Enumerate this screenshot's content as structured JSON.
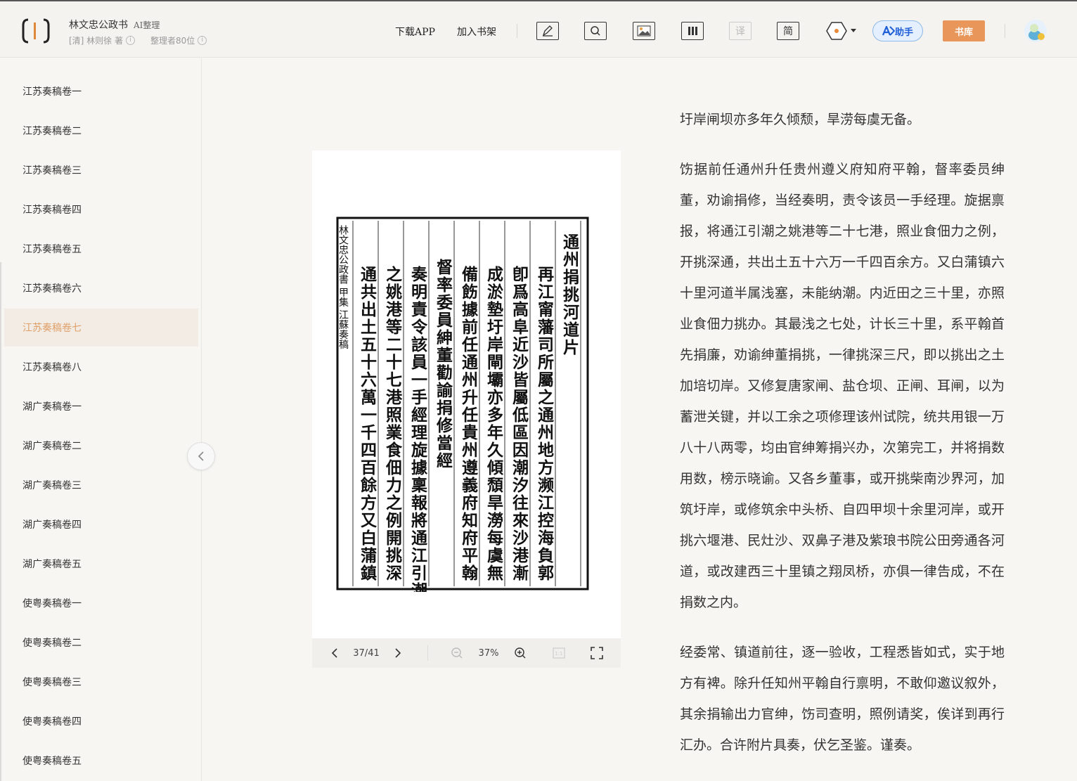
{
  "header": {
    "title": "林文忠公政书",
    "ai_tag": "AI整理",
    "author": "[清] 林则徐 著",
    "organizer": "整理者80位",
    "info_glyph": "i",
    "download_app": "下载APP",
    "add_shelf": "加入书架",
    "tools": {
      "note": "note-icon",
      "search": "search-icon",
      "image": "image-icon",
      "columns": "columns-icon",
      "translate": "译",
      "simplified": "简",
      "theme": "hexagon-theme-icon"
    },
    "ai_assistant": "助手",
    "library": "书库"
  },
  "sidebar": {
    "items": [
      {
        "label": "江苏奏稿卷一"
      },
      {
        "label": "江苏奏稿卷二"
      },
      {
        "label": "江苏奏稿卷三"
      },
      {
        "label": "江苏奏稿卷四"
      },
      {
        "label": "江苏奏稿卷五"
      },
      {
        "label": "江苏奏稿卷六"
      },
      {
        "label": "江苏奏稿卷七",
        "active": true
      },
      {
        "label": "江苏奏稿卷八"
      },
      {
        "label": "湖广奏稿卷一"
      },
      {
        "label": "湖广奏稿卷二"
      },
      {
        "label": "湖广奏稿卷三"
      },
      {
        "label": "湖广奏稿卷四"
      },
      {
        "label": "湖广奏稿卷五"
      },
      {
        "label": "使粤奏稿卷一"
      },
      {
        "label": "使粤奏稿卷二"
      },
      {
        "label": "使粤奏稿卷三"
      },
      {
        "label": "使粤奏稿卷四"
      },
      {
        "label": "使粤奏稿卷五"
      }
    ]
  },
  "viewer": {
    "page_indicator": "37/41",
    "zoom": "37%",
    "prev_glyph": "‹",
    "next_glyph": "›",
    "scan_columns": [
      "通州捐挑河道片",
      "再江甯藩司所屬之通州地方濒江控海負郭",
      "卽爲高阜近沙皆屬低區因潮汐往來沙港漸",
      "成淤墊圩岸閘壩亦多年久傾頹旱澇每虞無",
      "備飭據前任通州升任貴州遵義府知府平翰",
      "督率委員紳董勸諭捐修當經",
      "奏明責令該員一手經理旋據稟報將通江引潮",
      "之姚港等二十七港照業食佃力之例開挑深",
      "通共出土五十六萬一千四百餘方又白蒲鎮"
    ],
    "scan_margin": "林文忠公政書 甲集 江蘇奏稿"
  },
  "text": {
    "paragraphs": [
      "圩岸闸坝亦多年久倾颓，旱涝每虞无备。",
      "饬据前任通州升任贵州遵义府知府平翰，督率委员绅董，劝谕捐修，当经奏明，责令该员一手经理。旋据禀报，将通江引潮之姚港等二十七港，照业食佃力之例，开挑深通，共出土五十六万一千四百余方。又白蒲镇六十里河道半属浅塞，未能纳潮。内近田之三十里，亦照业食佃力挑办。其最浅之七处，计长三十里，系平翰首先捐廉，劝谕绅董捐挑，一律挑深三尺，即以挑出之土加培切岸。又修复唐家闸、盐仓坝、正闸、耳闸，以为蓄泄关键，并以工余之项修理该州试院，统共用银一万八十八两零，均由官绅筹捐兴办，次第完工，并将捐数用数，榜示晓谕。又各乡董事，或开挑柴南沙界河，加筑圩岸，或修筑余中头桥、自四甲坝十余里河岸，或开挑六堰港、民灶沙、双鼻子港及紫琅书院公田旁通各河道，或改建西三十里镇之翔凤桥，亦俱一律告成，不在捐数之内。",
      "经委常、镇道前往，逐一验收，工程悉皆如式，实于地方有裨。除升任知州平翰自行禀明，不敢仰邀议叙外，其余捐输出力官绅，饬司查明，照例请奖，俟详到再行汇办。合许附片具奏，伏乞圣鉴。谨奏。"
    ]
  }
}
